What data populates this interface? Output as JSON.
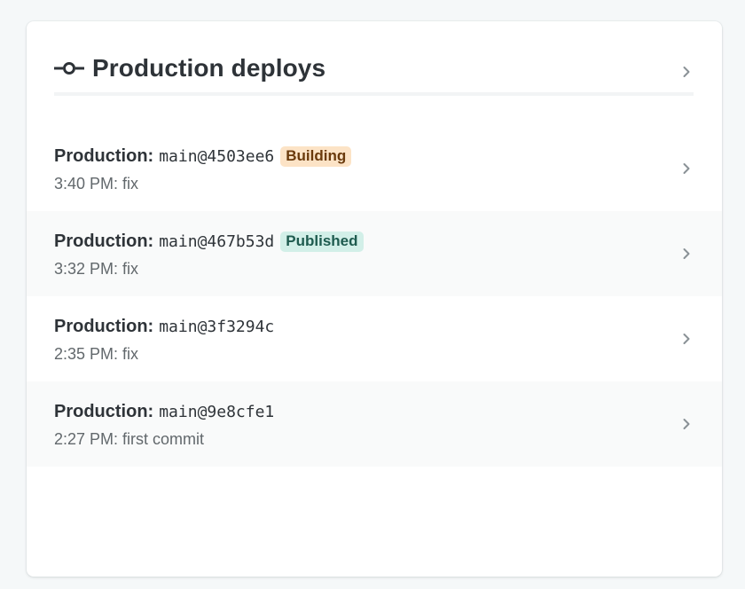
{
  "header": {
    "title": "Production deploys",
    "icon": "git-commit-icon"
  },
  "deploys": [
    {
      "label": "Production:",
      "ref": "main@4503ee6",
      "badge": "Building",
      "badge_type": "building",
      "meta": "3:40 PM: fix"
    },
    {
      "label": "Production:",
      "ref": "main@467b53d",
      "badge": "Published",
      "badge_type": "published",
      "meta": "3:32 PM: fix"
    },
    {
      "label": "Production:",
      "ref": "main@3f3294c",
      "badge": "",
      "badge_type": "",
      "meta": "2:35 PM: fix"
    },
    {
      "label": "Production:",
      "ref": "main@9e8cfe1",
      "badge": "",
      "badge_type": "",
      "meta": "2:27 PM: first commit"
    }
  ],
  "colors": {
    "text": "#2e3338",
    "muted": "#62686c",
    "building_bg": "#fce3c6",
    "building_fg": "#6a3a0c",
    "published_bg": "#d2efe8",
    "published_fg": "#1e5b4f"
  }
}
